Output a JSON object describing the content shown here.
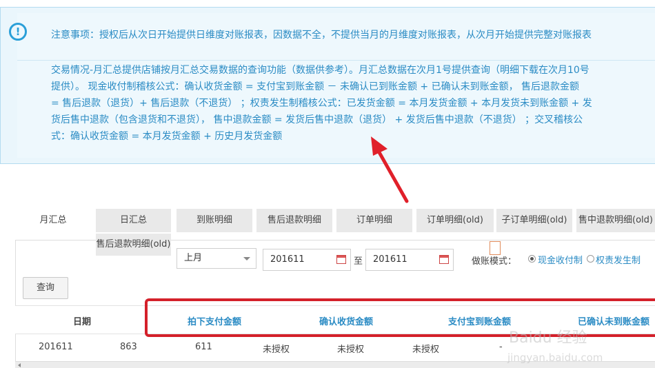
{
  "notice": {
    "icon": "info-icon",
    "line1": "注意事项：授权后从次日开始提供日维度对账报表，因数据不全，不提供当月的月维度对账报表，从次月开始提供完整对账报表",
    "para": [
      "交易情况-月汇总提供店铺按月汇总交易数据的查询功能（数据供参考）。月汇总数据在次月1号提供查询（明细下载在次月10号",
      "提供）。 现金收付制稽核公式：确认收货金额 = 支付宝到账金额 － 未确认已到账金额 + 已确认未到账金额， 售后退款金额",
      "= 售后退款（退货）+ 售后退款（不退货） ；权责发生制稽核公式：已发货金额 = 本月发货金额 + 本月发货未到账金额 + 发",
      "货后售中退款（包含退货和不退货）， 售中退款金额 = 发货后售中退款（退货） + 发货后售中退款（不退货） ；交叉稽核公",
      "式：确认收货金额 = 本月发货金额 + 历史月发货金额"
    ]
  },
  "tabs": [
    {
      "label": "月汇总",
      "active": true
    },
    {
      "label": "日汇总"
    },
    {
      "label": "到账明细"
    },
    {
      "label": "售后退款明细"
    },
    {
      "label": "订单明细"
    },
    {
      "label": "订单明细(old)"
    },
    {
      "label": "子订单明细(old)"
    },
    {
      "label": "售中退款明细(old)"
    },
    {
      "label": "售后退款明细(old)"
    }
  ],
  "filters": {
    "period_select": "上月",
    "start_date": "201611",
    "to_label": "至",
    "end_date": "201611",
    "mode_label": "做账模式：",
    "mode_options": [
      "现金收付制",
      "权责发生制"
    ],
    "mode_selected": "现金收付制",
    "query_button": "查询"
  },
  "table": {
    "headers": [
      "日期",
      "拍下支付金额",
      "确认收货金额",
      "支付宝到账金额",
      "已确认未到账金额"
    ],
    "row": [
      "201611",
      "863",
      "611",
      "未授权",
      "未授权",
      "未授权",
      "-"
    ]
  },
  "watermark": {
    "text": "Baidu 经验",
    "url": "jingyan.baidu.com"
  },
  "colors": {
    "accent_blue": "#2a8bc4",
    "highlight_red": "#d4202a",
    "arrow_red": "#e0202a"
  }
}
